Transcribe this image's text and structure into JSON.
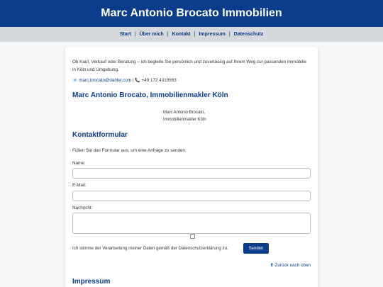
{
  "header": {
    "title": "Marc Antonio Brocato Immobilien"
  },
  "nav": {
    "items": [
      "Start",
      "Über mich",
      "Kontakt",
      "Impressum",
      "Datenschutz"
    ]
  },
  "intro": {
    "text": "Ob Kauf, Verkauf oder Beratung – ich begleite Sie persönlich und zuverlässig auf Ihrem Weg zur passenden Immobilie in Köln und Umgebung.",
    "email": "marc.brocato@dahler.com",
    "separator": "|",
    "phone": "+49 172 4319563"
  },
  "profile": {
    "heading": "Marc Antonio Brocato, Immobilienmakler Köln",
    "image_alt_line1": "Marc Antonio Brocato,",
    "image_alt_line2": "Immobilienmakler Köln"
  },
  "form": {
    "heading": "Kontaktformular",
    "intro": "Füllen Sie das Formular aus, um eine Anfrage zu senden:",
    "name_label": "Name:",
    "email_label": "E-Mail:",
    "message_label": "Nachricht:",
    "consent_text": "Ich stimme der Verarbeitung meiner Daten gemäß der Datenschutzerklärung zu.",
    "submit_label": "Senden",
    "consent_checked": false
  },
  "back_to_top": "⬆ Zurück nach oben",
  "impressum": {
    "heading": "Impressum"
  },
  "colors": {
    "primary": "#0b3d8c",
    "nav_bg": "#d5d8dd",
    "page_bg": "#f5f6f8"
  },
  "icons": {
    "email": "envelope-icon",
    "phone": "phone-icon"
  }
}
